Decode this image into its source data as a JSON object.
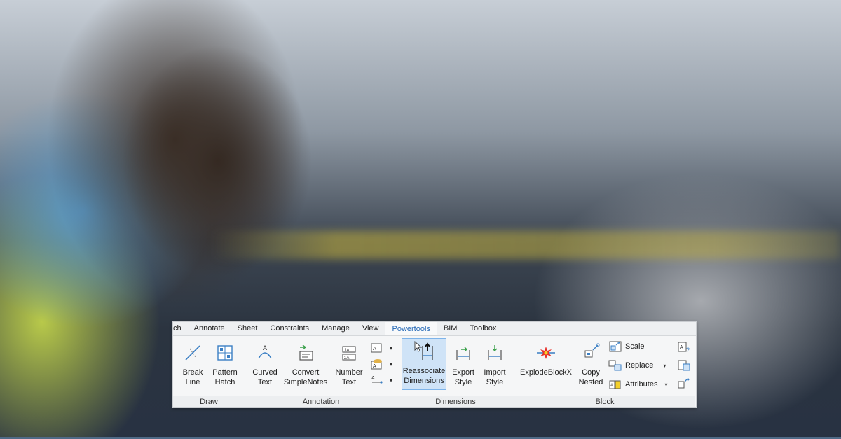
{
  "tabs": [
    {
      "label": "ch"
    },
    {
      "label": "Annotate"
    },
    {
      "label": "Sheet"
    },
    {
      "label": "Constraints"
    },
    {
      "label": "Manage"
    },
    {
      "label": "View"
    },
    {
      "label": "Powertools",
      "active": true
    },
    {
      "label": "BIM"
    },
    {
      "label": "Toolbox"
    }
  ],
  "panels": {
    "draw": {
      "title": "Draw",
      "break_line": {
        "line1": "Break",
        "line2": "Line",
        "icon": "break-line-icon"
      },
      "pattern_hatch": {
        "line1": "Pattern",
        "line2": "Hatch",
        "icon": "pattern-hatch-icon"
      }
    },
    "annotation": {
      "title": "Annotation",
      "curved_text": {
        "line1": "Curved",
        "line2": "Text",
        "icon": "curved-text-icon"
      },
      "convert_simplenotes": {
        "line1": "Convert",
        "line2": "SimpleNotes",
        "icon": "convert-notes-icon"
      },
      "number_text": {
        "line1": "Number",
        "line2": "Text",
        "icon": "number-text-icon"
      }
    },
    "dimensions": {
      "title": "Dimensions",
      "reassociate": {
        "line1": "Reassociate",
        "line2": "Dimensions",
        "icon": "reassociate-dimensions-icon"
      },
      "export_style": {
        "line1": "Export",
        "line2": "Style",
        "icon": "export-style-icon"
      },
      "import_style": {
        "line1": "Import",
        "line2": "Style",
        "icon": "import-style-icon"
      }
    },
    "block": {
      "title": "Block",
      "explode": {
        "line1": "ExplodeBlockX",
        "icon": "explode-block-icon"
      },
      "copy_nested": {
        "line1": "Copy",
        "line2": "Nested",
        "icon": "copy-nested-icon"
      },
      "scale": {
        "label": "Scale"
      },
      "replace": {
        "label": "Replace"
      },
      "attributes": {
        "label": "Attributes"
      }
    }
  },
  "colors": {
    "accent": "#1e64b4",
    "active_bg": "#cfe3f7",
    "active_border": "#7eb4ea"
  }
}
